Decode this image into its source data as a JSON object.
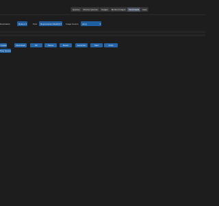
{
  "nav": {
    "tabs": [
      {
        "label": "Queries"
      },
      {
        "label": "Monitor Queries"
      },
      {
        "label": "Images"
      },
      {
        "label": "Monitor Images"
      },
      {
        "label": "Downloads"
      },
      {
        "label": "Help"
      }
    ],
    "active_tab": "Downloads"
  },
  "controls": {
    "destination": {
      "label": "Destination",
      "value": "Reference (all)"
    },
    "pool": {
      "label": "Pool",
      "value": "Reproduction Build(A)"
    },
    "image_source": {
      "label": "Image Source",
      "value": "(any)"
    }
  },
  "actions": {
    "buttons": [
      {
        "label": "Create"
      },
      {
        "label": "Download"
      },
      {
        "label": "Pin"
      },
      {
        "label": "Pause"
      },
      {
        "label": "Reset"
      },
      {
        "label": "Launcher"
      },
      {
        "label": "Start"
      },
      {
        "label": "Pods"
      }
    ],
    "second_row_button": {
      "label": "Stop Queue (Monitor)"
    }
  },
  "colors": {
    "background": "#1d1d1d",
    "accent": "#2466a8",
    "active_tab": "#4b5563"
  }
}
